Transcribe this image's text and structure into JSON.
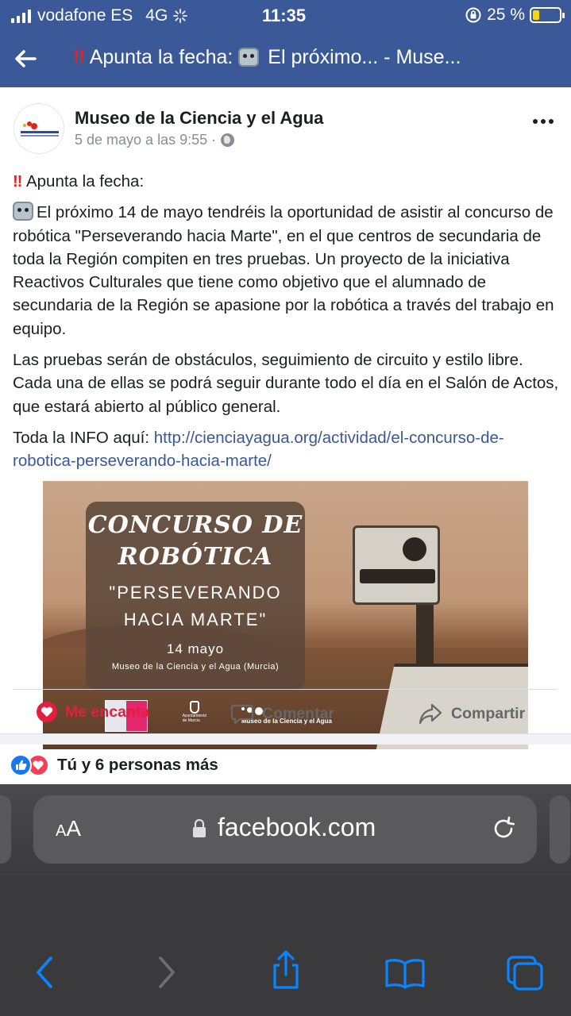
{
  "status_bar": {
    "carrier": "vodafone ES",
    "network": "4G",
    "time": "11:35",
    "battery_text": "25 %",
    "battery_level": 0.25
  },
  "header": {
    "title_prefix": "‼",
    "title": "Apunta la fecha:",
    "title_suffix": "El próximo... - Muse..."
  },
  "post": {
    "page_name": "Museo de la Ciencia y el Agua",
    "timestamp": "5 de mayo a las 9:55 ·",
    "avatar_text": "Museo de la Ciencia y el Agua",
    "line1_prefix": "‼",
    "line1": "Apunta la fecha:",
    "paragraph1": "El próximo 14 de mayo tendréis la oportunidad de asistir al concurso de robótica \"Perseverando hacia Marte\", en el que centros de secundaria de toda la Región compiten en tres pruebas. Un proyecto de la iniciativa Reactivos Culturales que tiene como objetivo que el alumnado de secundaria de la Región se apasione por la robótica a través del trabajo en equipo.",
    "paragraph2": "Las pruebas serán de obstáculos, seguimiento de circuito y estilo libre. Cada una de ellas se podrá seguir durante todo el día en el Salón de Actos, que estará abierto al público general.",
    "info_label": "Toda la INFO aquí:",
    "info_link": "http://cienciayagua.org/actividad/el-concurso-de-robotica-perseverando-hacia-marte/"
  },
  "poster": {
    "title_line1": "CONCURSO DE",
    "title_line2": "ROBÓTICA",
    "subtitle_line1": "\"PERSEVERANDO",
    "subtitle_line2": "HACIA MARTE\"",
    "date": "14 mayo",
    "venue": "Museo de la Ciencia y el Agua (Murcia)",
    "logo_ayto": "Ayuntamiento de Murcia",
    "logo_museo": "Museo de la Ciencia y el Agua"
  },
  "actions": {
    "like": "Me encanta",
    "comment": "Comentar",
    "share": "Compartir"
  },
  "reactions": {
    "summary": "Tú y 6 personas más"
  },
  "browser": {
    "aa_label_small": "A",
    "aa_label_big": "A",
    "url": "facebook.com"
  },
  "colors": {
    "facebook_blue": "#3b5998",
    "like_red": "#e41e3f",
    "link": "#385898",
    "safari_bg": "#3a3a3c"
  }
}
